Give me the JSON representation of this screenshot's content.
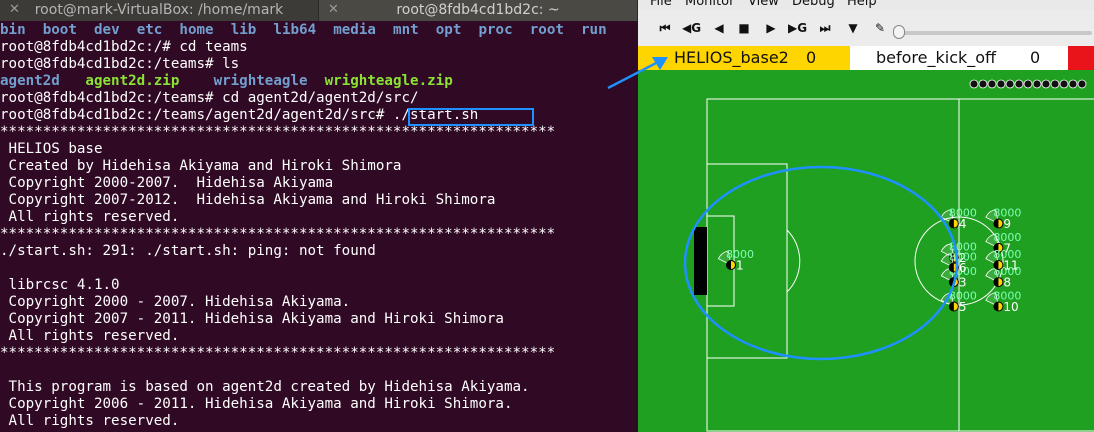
{
  "terminal": {
    "tabs": [
      {
        "title": "root@mark-VirtualBox: /home/mark",
        "close": "✕"
      },
      {
        "title": "root@8fdb4cd1bd2c: ~",
        "close": "✕"
      }
    ],
    "ls_root": [
      "bin",
      "boot",
      "dev",
      "etc",
      "home",
      "lib",
      "lib64",
      "media",
      "mnt",
      "opt",
      "proc",
      "root",
      "run"
    ],
    "line_cd_teams": "root@8fdb4cd1bd2c:/# cd teams",
    "line_ls": "root@8fdb4cd1bd2c:/teams# ls",
    "teams_entries": [
      {
        "name": "agent2d",
        "kind": "dir"
      },
      {
        "name": "agent2d.zip",
        "kind": "zip"
      },
      {
        "name": "wrighteagle",
        "kind": "dir"
      },
      {
        "name": "wrighteagle.zip",
        "kind": "zip"
      }
    ],
    "line_cd_src": "root@8fdb4cd1bd2c:/teams# cd agent2d/agent2d/src/",
    "prompt_src": "root@8fdb4cd1bd2c:/teams/agent2d/agent2d/src# ",
    "start_cmd": "./start.sh",
    "stars": "*****************************************************************",
    "helios_block": [
      " HELIOS base",
      " Created by Hidehisa Akiyama and Hiroki Shimora",
      " Copyright 2000-2007.  Hidehisa Akiyama",
      " Copyright 2007-2012.  Hidehisa Akiyama and Hiroki Shimora",
      " All rights reserved."
    ],
    "ping_error": "./start.sh: 291: ./start.sh: ping: not found",
    "librcsc_block": [
      " librcsc 4.1.0",
      " Copyright 2000 - 2007. Hidehisa Akiyama.",
      " Copyright 2007 - 2011. Hidehisa Akiyama and Hiroki Shimora",
      " All rights reserved."
    ],
    "based_block": [
      " This program is based on agent2d created by Hidehisa Akiyama.",
      " Copyright 2006 - 2011. Hidehisa Akiyama and Hiroki Shimora.",
      " All rights reserved."
    ]
  },
  "monitor": {
    "menu": [
      "File",
      "Monitor",
      "View",
      "Debug",
      "Help"
    ],
    "toolbar": [
      {
        "icon": "rewind-start-icon",
        "glyph": "⏮"
      },
      {
        "icon": "goal-rewind-icon",
        "glyph": "◀G"
      },
      {
        "icon": "step-back-icon",
        "glyph": "◀"
      },
      {
        "icon": "stop-icon",
        "glyph": "■"
      },
      {
        "icon": "play-icon",
        "glyph": "▶"
      },
      {
        "icon": "goal-forward-icon",
        "glyph": "▶G"
      },
      {
        "icon": "fast-forward-icon",
        "glyph": "⏭"
      },
      {
        "icon": "filter-icon",
        "glyph": "▼"
      },
      {
        "icon": "draw-icon",
        "glyph": "✎"
      }
    ],
    "score": {
      "left_team": "HELIOS_base2",
      "left_goals": "0",
      "play_mode": "before_kick_off",
      "right_goals": "0"
    },
    "colors": {
      "field": "#20a020",
      "left_team": "#ffd500",
      "right_flag": "#e8141a",
      "annotation": "#1e90ff"
    },
    "players": [
      {
        "num": "1",
        "stamina": "8000",
        "x": -49.0,
        "y": 0.0
      },
      {
        "num": "2",
        "stamina": "8000",
        "x": -16.5,
        "y": -1.5
      },
      {
        "num": "3",
        "stamina": "8000",
        "x": -16.5,
        "y": 3.5
      },
      {
        "num": "4",
        "stamina": "8000",
        "x": -16.5,
        "y": -8.5
      },
      {
        "num": "5",
        "stamina": "8000",
        "x": -16.5,
        "y": 8.5
      },
      {
        "num": "6",
        "stamina": "8000",
        "x": -16.5,
        "y": 0.5
      },
      {
        "num": "7",
        "stamina": "8000",
        "x": -10.0,
        "y": -3.5
      },
      {
        "num": "8",
        "stamina": "8000",
        "x": -10.0,
        "y": 3.5
      },
      {
        "num": "9",
        "stamina": "8000",
        "x": -10.0,
        "y": -8.5
      },
      {
        "num": "10",
        "stamina": "8000",
        "x": -10.0,
        "y": 8.5
      },
      {
        "num": "11",
        "stamina": "8000",
        "x": -10.0,
        "y": 0.0
      }
    ]
  }
}
